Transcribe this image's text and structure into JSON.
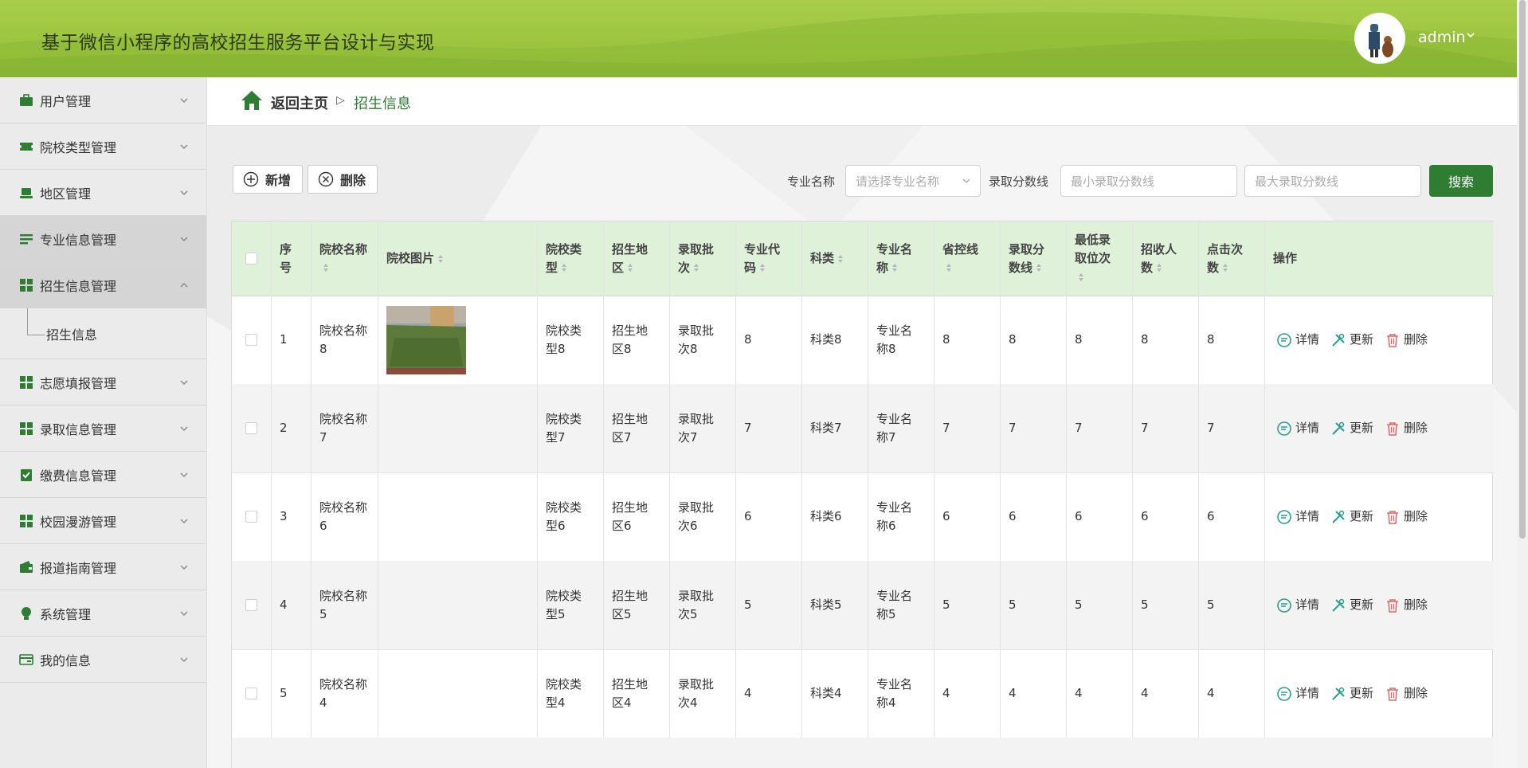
{
  "app": {
    "title": "基于微信小程序的高校招生服务平台设计与实现",
    "user": "admin"
  },
  "sidebar": {
    "items": [
      {
        "label": "用户管理",
        "icon": "briefcase-icon"
      },
      {
        "label": "院校类型管理",
        "icon": "ticket-icon"
      },
      {
        "label": "地区管理",
        "icon": "laptop-icon"
      },
      {
        "label": "专业信息管理",
        "icon": "list-icon",
        "active": true
      },
      {
        "label": "招生信息管理",
        "icon": "grid-icon",
        "active": true,
        "expanded": true
      },
      {
        "label": "志愿填报管理",
        "icon": "grid-icon"
      },
      {
        "label": "录取信息管理",
        "icon": "grid-icon"
      },
      {
        "label": "缴费信息管理",
        "icon": "clipboard-check-icon"
      },
      {
        "label": "校园漫游管理",
        "icon": "grid-icon"
      },
      {
        "label": "报道指南管理",
        "icon": "wallet-icon"
      },
      {
        "label": "系统管理",
        "icon": "bulb-icon"
      },
      {
        "label": "我的信息",
        "icon": "card-icon"
      }
    ],
    "sub_item": "招生信息"
  },
  "breadcrumb": {
    "home": "返回主页",
    "sep": "▷",
    "current": "招生信息"
  },
  "toolbar": {
    "add_label": "新增",
    "delete_label": "删除"
  },
  "filters": {
    "major_label": "专业名称",
    "major_placeholder": "请选择专业名称",
    "score_label": "录取分数线",
    "min_placeholder": "最小录取分数线",
    "max_placeholder": "最大录取分数线",
    "search_label": "搜索"
  },
  "table": {
    "headers": {
      "idx": "序号",
      "school": "院校名称",
      "image": "院校图片",
      "type": "院校类型",
      "region": "招生地区",
      "batch": "录取批次",
      "code": "专业代码",
      "category": "科类",
      "major": "专业名称",
      "control": "省控线",
      "score": "录取分数线",
      "rank": "最低录取位次",
      "enroll": "招收人数",
      "clicks": "点击次数",
      "ops": "操作"
    },
    "rows": [
      {
        "idx": "1",
        "school": "院校名称8",
        "type": "院校类型8",
        "region": "招生地区8",
        "batch": "录取批次8",
        "code": "8",
        "category": "科类8",
        "major": "专业名称8",
        "control": "8",
        "score": "8",
        "rank": "8",
        "enroll": "8",
        "clicks": "8"
      },
      {
        "idx": "2",
        "school": "院校名称7",
        "type": "院校类型7",
        "region": "招生地区7",
        "batch": "录取批次7",
        "code": "7",
        "category": "科类7",
        "major": "专业名称7",
        "control": "7",
        "score": "7",
        "rank": "7",
        "enroll": "7",
        "clicks": "7"
      },
      {
        "idx": "3",
        "school": "院校名称6",
        "type": "院校类型6",
        "region": "招生地区6",
        "batch": "录取批次6",
        "code": "6",
        "category": "科类6",
        "major": "专业名称6",
        "control": "6",
        "score": "6",
        "rank": "6",
        "enroll": "6",
        "clicks": "6"
      },
      {
        "idx": "4",
        "school": "院校名称5",
        "type": "院校类型5",
        "region": "招生地区5",
        "batch": "录取批次5",
        "code": "5",
        "category": "科类5",
        "major": "专业名称5",
        "control": "5",
        "score": "5",
        "rank": "5",
        "enroll": "5",
        "clicks": "5"
      },
      {
        "idx": "5",
        "school": "院校名称4",
        "type": "院校类型4",
        "region": "招生地区4",
        "batch": "录取批次4",
        "code": "4",
        "category": "科类4",
        "major": "专业名称4",
        "control": "4",
        "score": "4",
        "rank": "4",
        "enroll": "4",
        "clicks": "4"
      }
    ],
    "actions": {
      "detail": "详情",
      "update": "更新",
      "delete": "删除"
    }
  },
  "colors": {
    "primary": "#2e7d32",
    "header": "#9cc43e",
    "thead": "#dff2d9",
    "danger": "#e06666",
    "teal": "#2a9d8f"
  }
}
